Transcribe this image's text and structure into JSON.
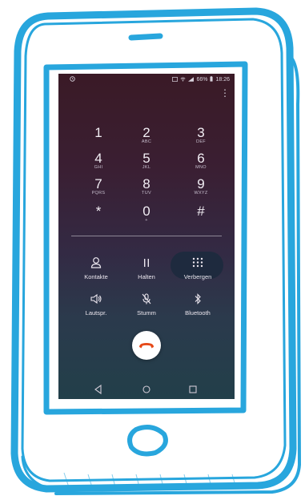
{
  "statusbar": {
    "left_icon": "alarm-icon",
    "battery_text": "66%",
    "time": "18:26"
  },
  "keypad": [
    {
      "digit": "1",
      "letters": ""
    },
    {
      "digit": "2",
      "letters": "ABC"
    },
    {
      "digit": "3",
      "letters": "DEF"
    },
    {
      "digit": "4",
      "letters": "GHI"
    },
    {
      "digit": "5",
      "letters": "JKL"
    },
    {
      "digit": "6",
      "letters": "MNO"
    },
    {
      "digit": "7",
      "letters": "PQRS"
    },
    {
      "digit": "8",
      "letters": "TUV"
    },
    {
      "digit": "9",
      "letters": "WXYZ"
    },
    {
      "digit": "*",
      "letters": ""
    },
    {
      "digit": "0",
      "letters": "+"
    },
    {
      "digit": "#",
      "letters": ""
    }
  ],
  "actions": {
    "contacts": "Kontakte",
    "hold": "Halten",
    "hide": "Verbergen",
    "speaker": "Lautspr.",
    "mute": "Stumm",
    "bluetooth": "Bluetooth"
  },
  "colors": {
    "frame": "#28a6dd",
    "end_call": "#e64a19",
    "highlight": "#1e2a3e"
  }
}
